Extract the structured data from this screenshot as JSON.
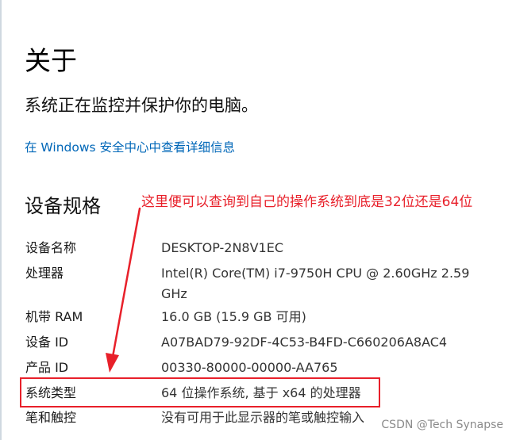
{
  "page": {
    "title": "关于",
    "subtitle": "系统正在监控并保护你的电脑。",
    "security_link": "在 Windows 安全中心中查看详细信息",
    "section_title": "设备规格"
  },
  "annotation": {
    "text": "这里便可以查询到自己的操作系统到底是32位还是64位",
    "color": "#e8202a"
  },
  "specs": [
    {
      "label": "设备名称",
      "value": "DESKTOP-2N8V1EC"
    },
    {
      "label": "处理器",
      "value": "Intel(R) Core(TM) i7-9750H CPU @ 2.60GHz   2.59 GHz"
    },
    {
      "label": "机带 RAM",
      "value": "16.0 GB (15.9 GB 可用)"
    },
    {
      "label": "设备 ID",
      "value": "A07BAD79-92DF-4C53-B4FD-C660206A8AC4"
    },
    {
      "label": "产品 ID",
      "value": "00330-80000-00000-AA765"
    },
    {
      "label": "系统类型",
      "value": "64 位操作系统, 基于 x64 的处理器"
    },
    {
      "label": "笔和触控",
      "value": "没有可用于此显示器的笔或触控输入"
    }
  ],
  "watermark": "CSDN @Tech Synapse",
  "colors": {
    "link": "#0067b8",
    "annotation": "#e8202a"
  }
}
